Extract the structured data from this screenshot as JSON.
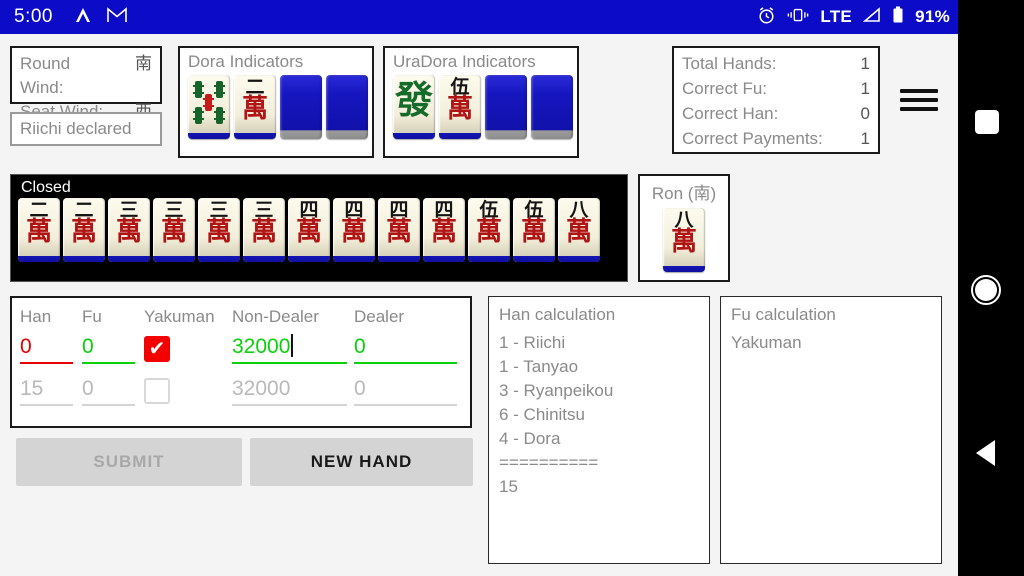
{
  "statusbar": {
    "time": "5:00",
    "left_icons": [
      "caret-icon",
      "gmail-icon"
    ],
    "right_icons": [
      "alarm-icon",
      "vibrate-icon",
      "signal-icon"
    ],
    "network": "LTE",
    "battery_percent": "91%",
    "bg_color": "#0c0cc8"
  },
  "winds": {
    "round_label": "Round Wind:",
    "round_value": "南",
    "seat_label": "Seat Wind:",
    "seat_value": "西"
  },
  "riichi": {
    "label": "Riichi declared"
  },
  "dora": {
    "title": "Dora Indicators",
    "tiles": [
      {
        "kind": "sou",
        "value": "5",
        "face": "up"
      },
      {
        "kind": "man",
        "num": "二",
        "suit": "萬",
        "face": "up"
      },
      {
        "kind": "back",
        "face": "down"
      },
      {
        "kind": "back",
        "face": "down"
      }
    ]
  },
  "uradora": {
    "title": "UraDora Indicators",
    "tiles": [
      {
        "kind": "honor",
        "char": "發",
        "face": "up"
      },
      {
        "kind": "man",
        "num": "伍",
        "suit": "萬",
        "face": "up"
      },
      {
        "kind": "back",
        "face": "down"
      },
      {
        "kind": "back",
        "face": "down"
      }
    ]
  },
  "stats": {
    "rows": [
      {
        "label": "Total Hands:",
        "value": "1"
      },
      {
        "label": "Correct Fu:",
        "value": "1"
      },
      {
        "label": "Correct Han:",
        "value": "0"
      },
      {
        "label": "Correct Payments:",
        "value": "1"
      }
    ]
  },
  "menu": {
    "label": "menu"
  },
  "hand": {
    "label": "Closed",
    "tiles": [
      {
        "num": "二",
        "suit": "萬"
      },
      {
        "num": "二",
        "suit": "萬"
      },
      {
        "num": "三",
        "suit": "萬"
      },
      {
        "num": "三",
        "suit": "萬"
      },
      {
        "num": "三",
        "suit": "萬"
      },
      {
        "num": "三",
        "suit": "萬"
      },
      {
        "num": "四",
        "suit": "萬"
      },
      {
        "num": "四",
        "suit": "萬"
      },
      {
        "num": "四",
        "suit": "萬"
      },
      {
        "num": "四",
        "suit": "萬"
      },
      {
        "num": "伍",
        "suit": "萬"
      },
      {
        "num": "伍",
        "suit": "萬"
      },
      {
        "num": "八",
        "suit": "萬"
      }
    ]
  },
  "ron": {
    "title": "Ron (南)",
    "tile": {
      "num": "八",
      "suit": "萬"
    }
  },
  "form": {
    "headers": {
      "han": "Han",
      "fu": "Fu",
      "yakuman": "Yakuman",
      "non_dealer": "Non-Dealer",
      "dealer": "Dealer"
    },
    "entry": {
      "han": "0",
      "fu": "0",
      "yakuman_checked": "✔",
      "non_dealer": "32000",
      "dealer": "0"
    },
    "answer": {
      "han": "15",
      "fu": "0",
      "yakuman_checked": "",
      "non_dealer": "32000",
      "dealer": "0"
    },
    "colors": {
      "wrong": "#e60000",
      "correct": "#0ad10a",
      "answer": "#b9b9b9",
      "checkbox_checked": "#f40000"
    }
  },
  "buttons": {
    "submit": "SUBMIT",
    "new_hand": "NEW HAND"
  },
  "han_calculation": {
    "title": "Han calculation",
    "lines": [
      "1 - Riichi",
      "1 - Tanyao",
      "3 - Ryanpeikou",
      "6 - Chinitsu",
      "4 - Dora",
      "==========",
      "15"
    ]
  },
  "fu_calculation": {
    "title": "Fu calculation",
    "lines": [
      "Yakuman"
    ]
  },
  "navbar": {
    "recents": "recents-square-icon",
    "home": "home-circle-icon",
    "back": "back-triangle-icon"
  }
}
